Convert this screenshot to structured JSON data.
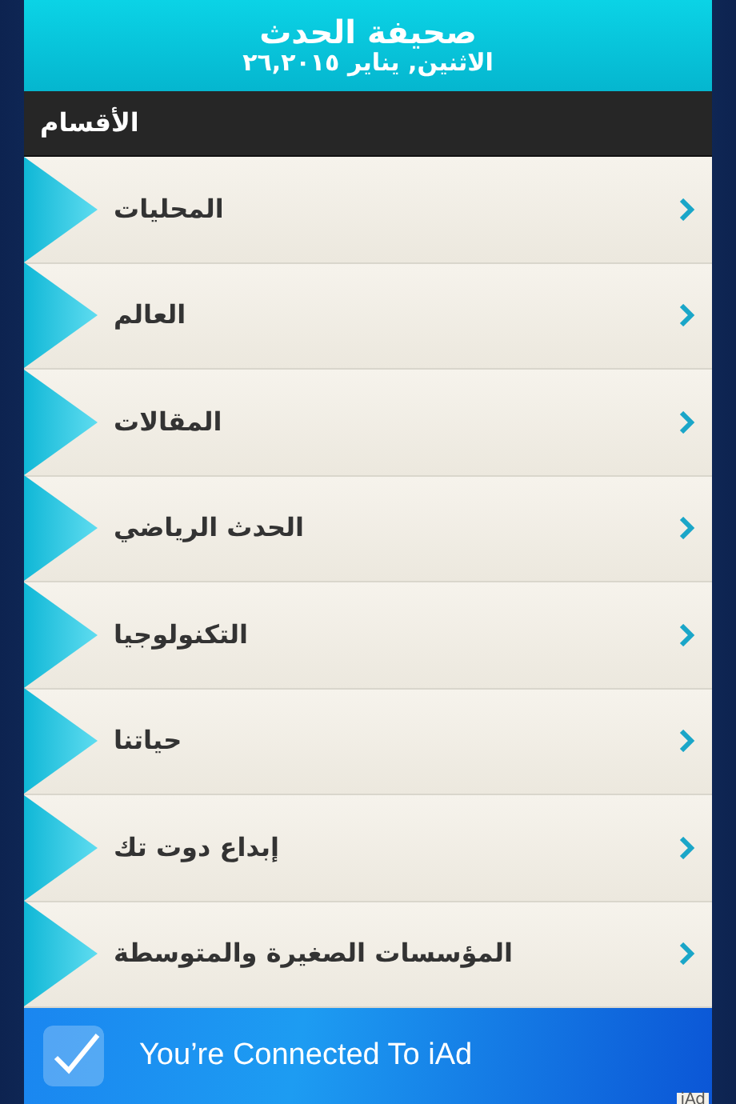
{
  "header": {
    "title": "صحيفة الحدث",
    "date": "الاثنين, يناير ٢٦,٢٠١٥"
  },
  "section_bar": {
    "title": "الأقسام"
  },
  "sections": [
    {
      "label": "المحليات"
    },
    {
      "label": "العالم"
    },
    {
      "label": "المقالات"
    },
    {
      "label": "الحدث الرياضي"
    },
    {
      "label": "التكنولوجيا"
    },
    {
      "label": "حياتنا"
    },
    {
      "label": "إبداع دوت تك"
    },
    {
      "label": "المؤسسات الصغيرة والمتوسطة"
    }
  ],
  "ad_banner": {
    "text": "You’re Connected To iAd",
    "checked": true,
    "corner_label": "iAd"
  }
}
